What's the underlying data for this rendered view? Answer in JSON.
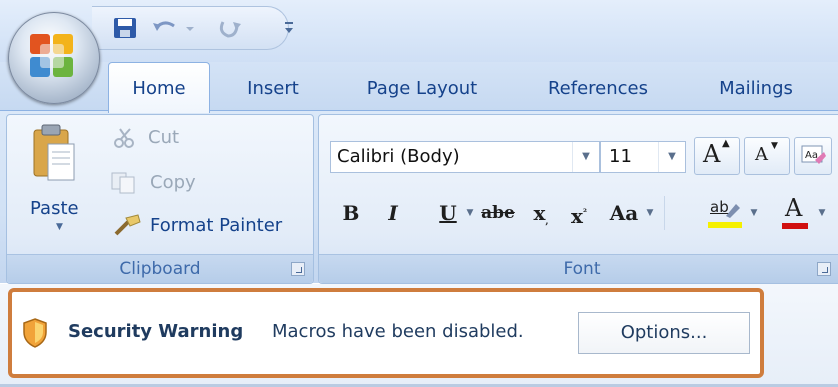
{
  "tabs": [
    {
      "label": "Home"
    },
    {
      "label": "Insert"
    },
    {
      "label": "Page Layout"
    },
    {
      "label": "References"
    },
    {
      "label": "Mailings"
    }
  ],
  "clipboard": {
    "paste_label": "Paste",
    "cut_label": "Cut",
    "copy_label": "Copy",
    "format_painter_label": "Format Painter",
    "group_label": "Clipboard"
  },
  "font": {
    "font_name": "Calibri (Body)",
    "font_size": "11",
    "bold": "B",
    "italic": "I",
    "underline": "U",
    "strikethrough": "abe",
    "subscript": "x",
    "superscript": "x",
    "change_case": "Aa",
    "grow_font": "A",
    "shrink_font": "A",
    "highlight": "ab",
    "font_color": "A",
    "group_label": "Font"
  },
  "message_bar": {
    "title": "Security Warning",
    "message": "Macros have been disabled.",
    "options_label": "Options..."
  },
  "colors": {
    "accent_highlight": "#cf7d3d",
    "ribbon_text": "#15428b",
    "font_color_bar": "#d01010",
    "highlight_bar": "#f5f000"
  }
}
